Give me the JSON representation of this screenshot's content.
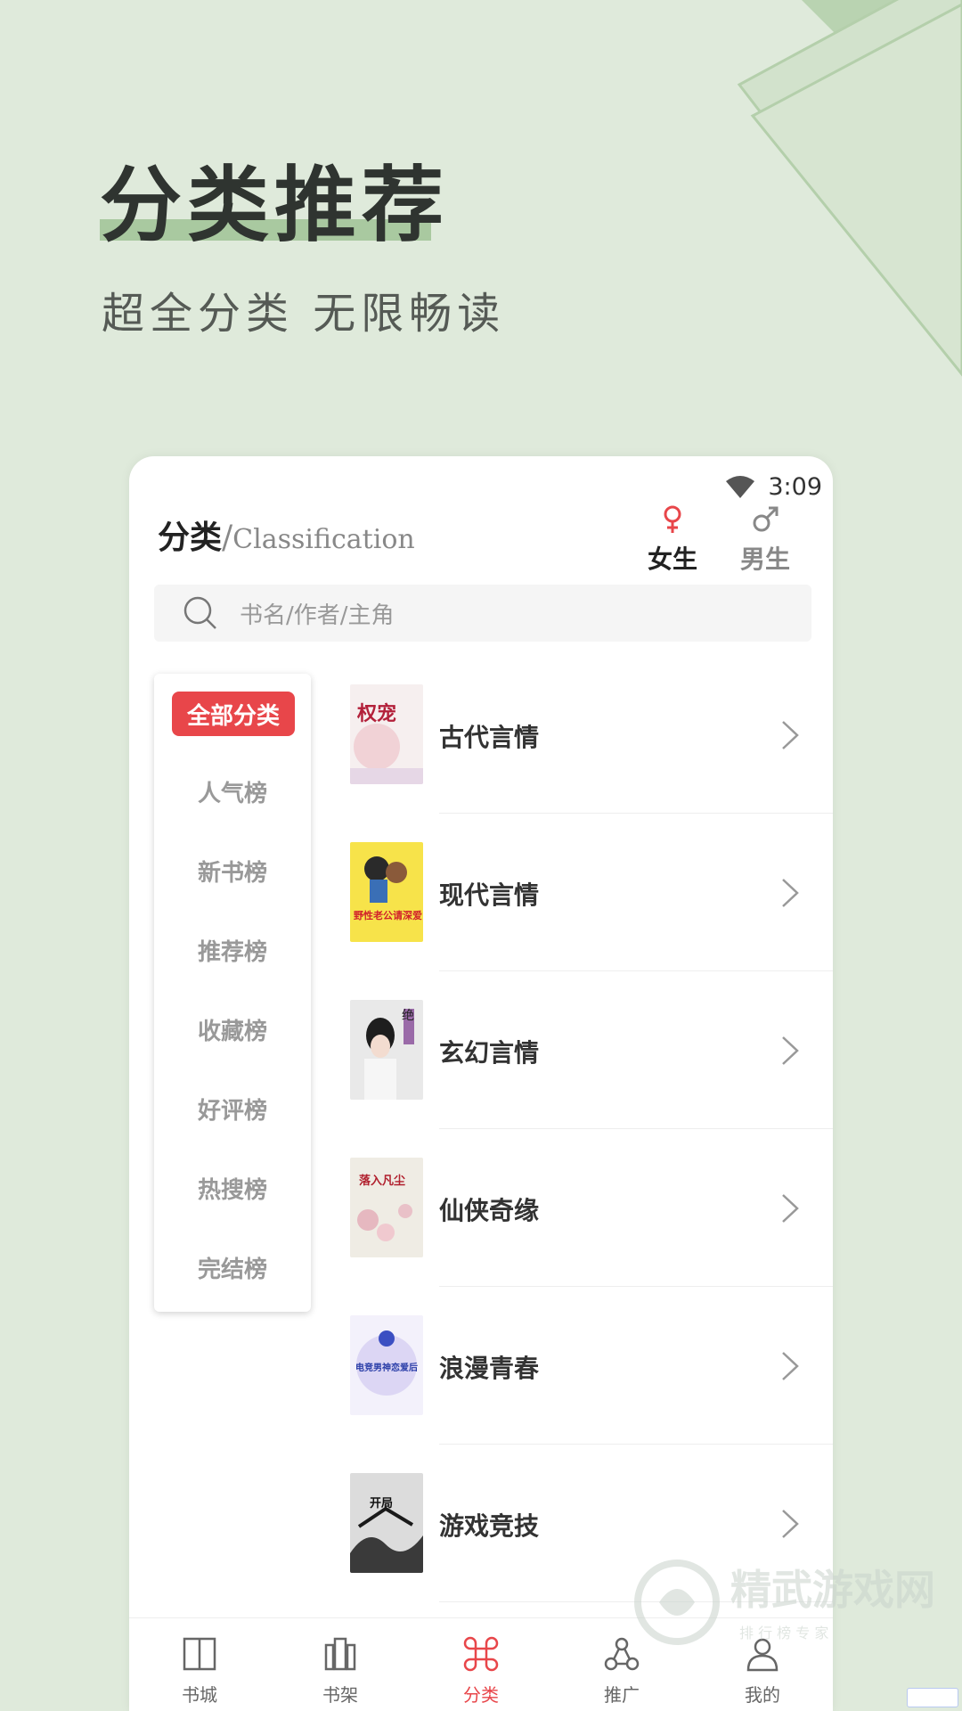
{
  "promo": {
    "title": "分类推荐",
    "subtitle": "超全分类 无限畅读"
  },
  "status_bar": {
    "time": "3:09"
  },
  "header": {
    "title_cn": "分类",
    "title_sep": "/",
    "title_en": "Classification",
    "gender_tabs": [
      {
        "label": "女生",
        "icon": "female-icon",
        "active": true,
        "color": "#e8464a"
      },
      {
        "label": "男生",
        "icon": "male-icon",
        "active": false,
        "color": "#888888"
      }
    ]
  },
  "search": {
    "placeholder": "书名/作者/主角"
  },
  "left_menu": {
    "active": "全部分类",
    "items": [
      "人气榜",
      "新书榜",
      "推荐榜",
      "收藏榜",
      "好评榜",
      "热搜榜",
      "完结榜"
    ]
  },
  "categories": [
    {
      "name": "古代言情",
      "cover_text": "权宠"
    },
    {
      "name": "现代言情",
      "cover_text": "野性老公请深爱!"
    },
    {
      "name": "玄幻言情",
      "cover_text": "绝"
    },
    {
      "name": "仙侠奇缘",
      "cover_text": "落入凡尘"
    },
    {
      "name": "浪漫青春",
      "cover_text": "电竞男神恋爱后"
    },
    {
      "name": "游戏竞技",
      "cover_text": "开局"
    }
  ],
  "bottom_nav": [
    {
      "label": "书城",
      "icon": "book-city-icon",
      "active": false
    },
    {
      "label": "书架",
      "icon": "bookshelf-icon",
      "active": false
    },
    {
      "label": "分类",
      "icon": "category-icon",
      "active": true
    },
    {
      "label": "推广",
      "icon": "share-icon",
      "active": false
    },
    {
      "label": "我的",
      "icon": "profile-icon",
      "active": false
    }
  ],
  "watermark": {
    "text": "精武游戏网",
    "sub": "排 行 榜 专 家"
  },
  "colors": {
    "background": "#dfeadb",
    "accent": "#e8464a",
    "title_highlight": "#a9c9a0"
  }
}
